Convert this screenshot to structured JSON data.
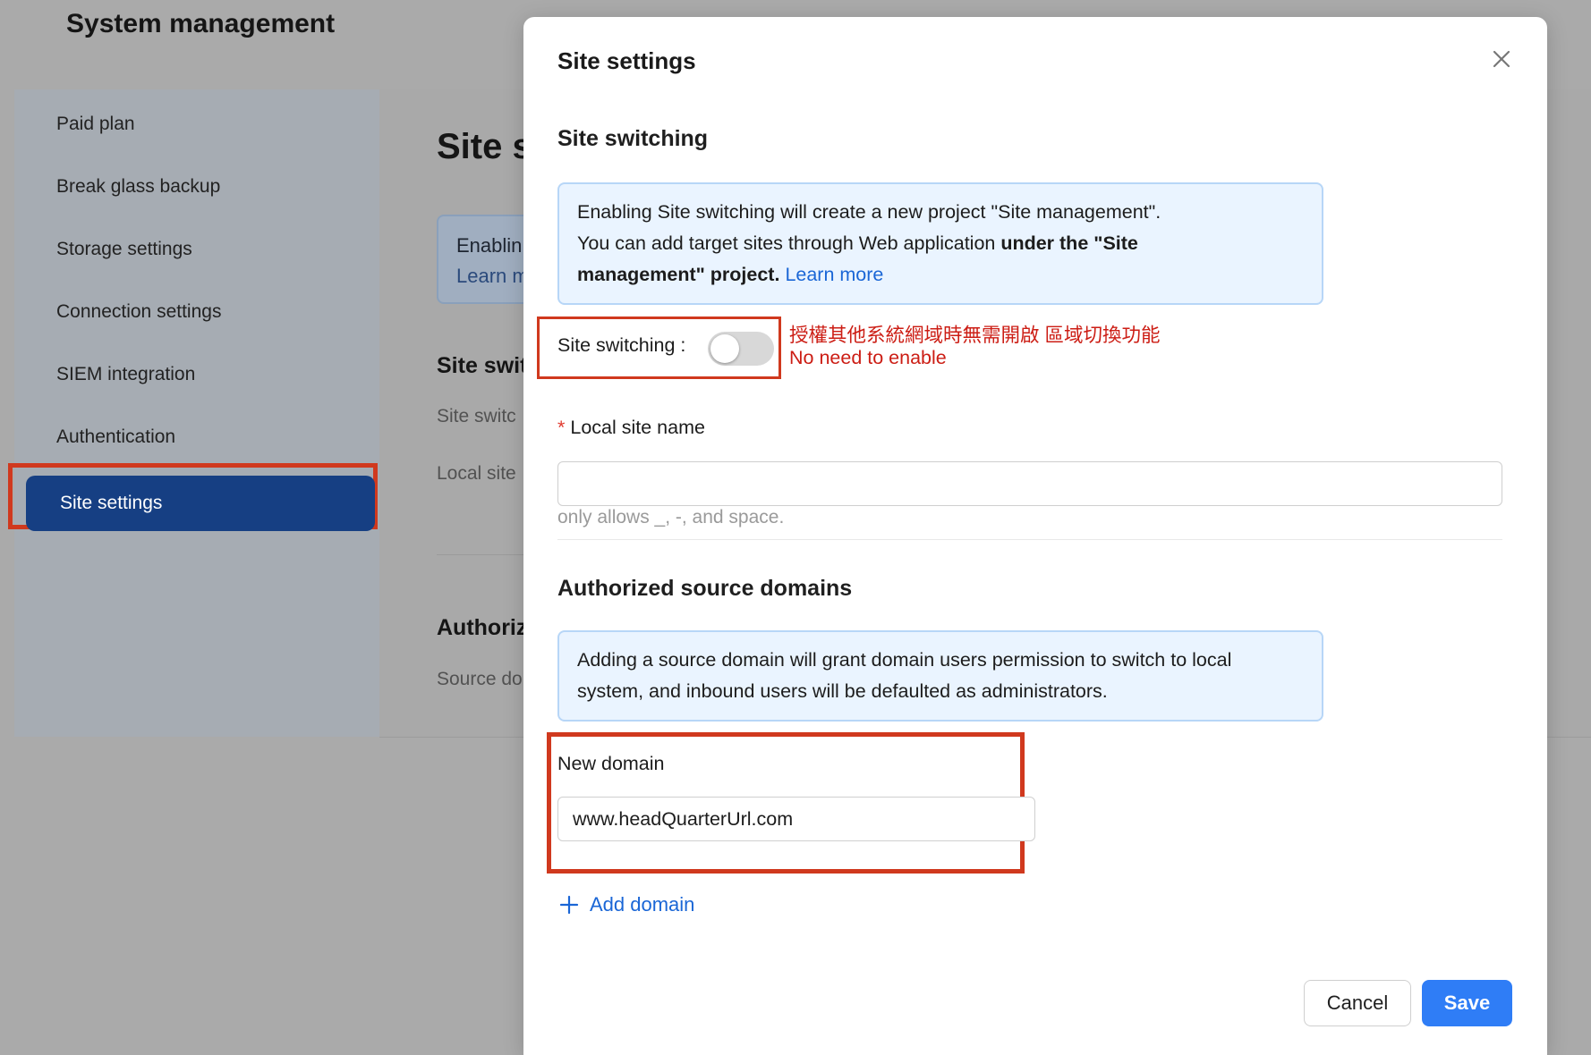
{
  "page": {
    "title": "System management"
  },
  "sidebar": {
    "items": [
      {
        "label": "Paid plan"
      },
      {
        "label": "Break glass backup"
      },
      {
        "label": "Storage settings"
      },
      {
        "label": "Connection settings"
      },
      {
        "label": "SIEM integration"
      },
      {
        "label": "Authentication"
      },
      {
        "label": "Site settings",
        "active": true
      }
    ]
  },
  "background": {
    "heading": "Site s",
    "alert_line1": "Enablin",
    "alert_line2": "Learn m",
    "site_switching_title": "Site swit",
    "site_switching_text": "Site switc",
    "local_site_text": "Local site",
    "authorized_title": "Authoriz",
    "source_text": "Source do"
  },
  "modal": {
    "title": "Site settings",
    "site_switching": {
      "title": "Site switching",
      "info_line1": "Enabling Site switching will create a new project \"Site management\".",
      "info_line2_plain": "You can add target sites through Web application ",
      "info_line2_bold": "under the \"Site",
      "info_line3_bold": "management\" project.",
      "learn_more": "Learn more",
      "switch_label": "Site switching :",
      "switch_on": false,
      "annotation_zh": "授權其他系統網域時無需開啟 區域切換功能",
      "annotation_en": "No need to enable"
    },
    "local_site": {
      "required_mark": "*",
      "label": "Local site name",
      "value": "",
      "help": "only allows _, -, and space."
    },
    "authorized_domains": {
      "title": "Authorized source domains",
      "info_line1": "Adding a source domain will grant domain users permission to switch to local",
      "info_line2": "system, and inbound users will be defaulted as administrators.",
      "new_domain_label": "New domain",
      "new_domain_value": "www.headQuarterUrl.com",
      "add_domain_label": "Add domain"
    },
    "buttons": {
      "cancel": "Cancel",
      "save": "Save"
    }
  },
  "colors": {
    "accent_blue": "#2f7df6",
    "link_blue": "#1a66d6",
    "sidebar_active": "#163f83",
    "annotation_red": "#d0391e"
  }
}
